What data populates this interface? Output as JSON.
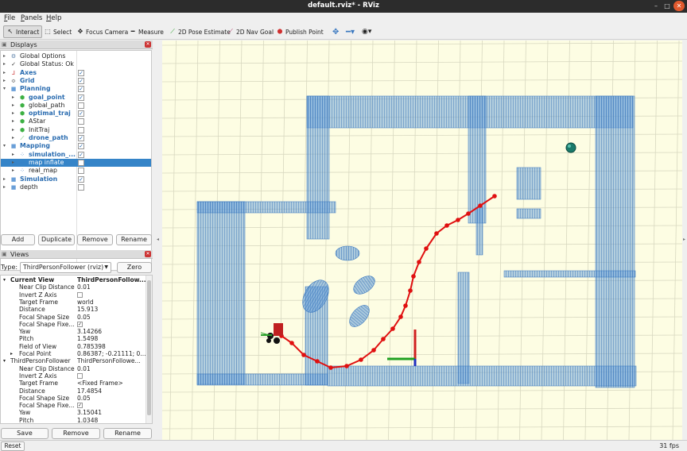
{
  "window": {
    "title": "default.rviz* - RViz",
    "controls": [
      "–",
      "□",
      "✕"
    ]
  },
  "menu": [
    "File",
    "Panels",
    "Help"
  ],
  "toolbar": {
    "tools": [
      {
        "label": "Interact",
        "icon": "interact-icon",
        "glyph": "↖"
      },
      {
        "label": "Select",
        "icon": "select-icon",
        "glyph": "⬚"
      },
      {
        "label": "Focus Camera",
        "icon": "focus-camera-icon",
        "glyph": "✥"
      },
      {
        "label": "Measure",
        "icon": "measure-icon",
        "glyph": "━"
      },
      {
        "label": "2D Pose Estimate",
        "icon": "pose-estimate-icon",
        "glyph": "⟋"
      },
      {
        "label": "2D Nav Goal",
        "icon": "nav-goal-icon",
        "glyph": "⟋"
      },
      {
        "label": "Publish Point",
        "icon": "publish-point-icon",
        "glyph": "⬤"
      }
    ],
    "extra_icons": [
      "move-camera-icon",
      "zoom-out-icon",
      "view-icon"
    ]
  },
  "displays": {
    "title": "Displays",
    "rows": [
      {
        "label": "Global Options",
        "depth": 0,
        "style": "plain",
        "icon": "gear-icon",
        "glyph": "⚙",
        "iconColor": "#5a7fa8",
        "arrow": "▸",
        "check": null
      },
      {
        "label": "Global Status: Ok",
        "depth": 0,
        "style": "plain",
        "icon": "status-ok-icon",
        "glyph": "✓",
        "iconColor": "#333",
        "arrow": "▸",
        "check": null
      },
      {
        "label": "Axes",
        "depth": 0,
        "style": "blue",
        "icon": "axes-icon",
        "glyph": "⅃",
        "iconColor": "#c33",
        "arrow": "▸",
        "check": true
      },
      {
        "label": "Grid",
        "depth": 0,
        "style": "blue",
        "icon": "grid-icon",
        "glyph": "≎",
        "iconColor": "#555",
        "arrow": "▸",
        "check": true
      },
      {
        "label": "Planning",
        "depth": 0,
        "style": "blue",
        "icon": "folder-icon",
        "glyph": "■",
        "iconColor": "#6a9fd8",
        "arrow": "▾",
        "check": true
      },
      {
        "label": "goal_point",
        "depth": 1,
        "style": "blue",
        "icon": "marker-icon",
        "glyph": "⬢",
        "iconColor": "#3cb043",
        "arrow": "▸",
        "check": true
      },
      {
        "label": "global_path",
        "depth": 1,
        "style": "plain",
        "icon": "marker-icon",
        "glyph": "⬢",
        "iconColor": "#3cb043",
        "arrow": "▸",
        "check": false
      },
      {
        "label": "optimal_traj",
        "depth": 1,
        "style": "blue",
        "icon": "marker-icon",
        "glyph": "⬢",
        "iconColor": "#3cb043",
        "arrow": "▸",
        "check": true
      },
      {
        "label": "AStar",
        "depth": 1,
        "style": "plain",
        "icon": "marker-icon",
        "glyph": "⬢",
        "iconColor": "#3cb043",
        "arrow": "▸",
        "check": false
      },
      {
        "label": "InitTraj",
        "depth": 1,
        "style": "plain",
        "icon": "marker-icon",
        "glyph": "⬢",
        "iconColor": "#3cb043",
        "arrow": "▸",
        "check": false
      },
      {
        "label": "drone_path",
        "depth": 1,
        "style": "blue",
        "icon": "path-icon",
        "glyph": "⟋",
        "iconColor": "#3cb043",
        "arrow": "▸",
        "check": true
      },
      {
        "label": "Mapping",
        "depth": 0,
        "style": "blue",
        "icon": "folder-icon",
        "glyph": "■",
        "iconColor": "#6a9fd8",
        "arrow": "▾",
        "check": true
      },
      {
        "label": "simulation_...",
        "depth": 1,
        "style": "blue",
        "icon": "pointcloud-icon",
        "glyph": "⁘",
        "iconColor": "#3a7ac0",
        "arrow": "▸",
        "check": true
      },
      {
        "label": "map inflate",
        "depth": 1,
        "style": "plain",
        "icon": "pointcloud-icon",
        "glyph": "⁘",
        "iconColor": "#3a7ac0",
        "arrow": "▸",
        "check": false,
        "selected": true
      },
      {
        "label": "real_map",
        "depth": 1,
        "style": "plain",
        "icon": "pointcloud-icon",
        "glyph": "⁘",
        "iconColor": "#3a7ac0",
        "arrow": "▸",
        "check": false
      },
      {
        "label": "Simulation",
        "depth": 0,
        "style": "blue",
        "icon": "folder-icon",
        "glyph": "■",
        "iconColor": "#6a9fd8",
        "arrow": "▸",
        "check": true
      },
      {
        "label": "depth",
        "depth": 0,
        "style": "plain",
        "icon": "folder-icon",
        "glyph": "■",
        "iconColor": "#6a9fd8",
        "arrow": "▸",
        "check": false
      }
    ],
    "buttons": [
      "Add",
      "Duplicate",
      "Remove",
      "Rename"
    ]
  },
  "views": {
    "title": "Views",
    "type_label": "Type:",
    "type_value": "ThirdPersonFollower (rviz)",
    "zero_label": "Zero",
    "properties": [
      {
        "key": "Current View",
        "value": "ThirdPersonFollow...",
        "depth": 0,
        "bold": true,
        "arrow": "▾"
      },
      {
        "key": "Near Clip Distance",
        "value": "0.01",
        "depth": 1
      },
      {
        "key": "Invert Z Axis",
        "check": false,
        "depth": 1
      },
      {
        "key": "Target Frame",
        "value": "world",
        "depth": 1
      },
      {
        "key": "Distance",
        "value": "15.913",
        "depth": 1
      },
      {
        "key": "Focal Shape Size",
        "value": "0.05",
        "depth": 1
      },
      {
        "key": "Focal Shape Fixe...",
        "check": true,
        "depth": 1
      },
      {
        "key": "Yaw",
        "value": "3.14266",
        "depth": 1
      },
      {
        "key": "Pitch",
        "value": "1.5498",
        "depth": 1
      },
      {
        "key": "Field of View",
        "value": "0.785398",
        "depth": 1
      },
      {
        "key": "Focal Point",
        "value": "0.86387; -0.21111; 0....",
        "depth": 1,
        "arrow": "▸"
      },
      {
        "key": "ThirdPersonFollower",
        "value": "ThirdPersonFollowe...",
        "depth": 0,
        "arrow": "▾"
      },
      {
        "key": "Near Clip Distance",
        "value": "0.01",
        "depth": 1
      },
      {
        "key": "Invert Z Axis",
        "check": false,
        "depth": 1
      },
      {
        "key": "Target Frame",
        "value": "<Fixed Frame>",
        "depth": 1
      },
      {
        "key": "Distance",
        "value": "17.4854",
        "depth": 1
      },
      {
        "key": "Focal Shape Size",
        "value": "0.05",
        "depth": 1
      },
      {
        "key": "Focal Shape Fixe...",
        "check": true,
        "depth": 1
      },
      {
        "key": "Yaw",
        "value": "3.15041",
        "depth": 1
      },
      {
        "key": "Pitch",
        "value": "1.0348",
        "depth": 1
      }
    ],
    "buttons": [
      "Save",
      "Remove",
      "Rename"
    ]
  },
  "status": {
    "reset_label": "Reset",
    "fps": "31 fps"
  },
  "scene": {
    "background": "#fdfde3",
    "grid_color": "#d8d8c0",
    "wall_color": "#4a8ad0",
    "path_color": "#e01010",
    "goal_color": "#1a7a6a"
  }
}
